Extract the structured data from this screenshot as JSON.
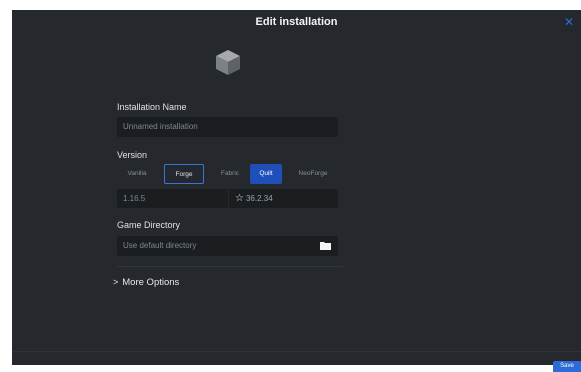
{
  "dialog": {
    "title": "Edit installation",
    "close_icon": "close-icon"
  },
  "installation_name": {
    "label": "Installation Name",
    "placeholder": "Unnamed installation"
  },
  "version": {
    "label": "Version",
    "loaders": [
      "Vanilla",
      "Forge",
      "Fabric",
      "Quilt",
      "NeoForge"
    ],
    "minecraft_version": "1.16.5",
    "loader_version": "36.2.34",
    "loader_version_icon": "star-icon"
  },
  "game_directory": {
    "label": "Game Directory",
    "placeholder": "Use default directory",
    "icon": "folder-icon"
  },
  "more_options": {
    "label": "More Options",
    "icon": "chevron-right-icon"
  },
  "footer": {
    "save_label": "Save"
  },
  "colors": {
    "background": "#25292d",
    "field": "#1b1e21",
    "accent": "#2d6bd6",
    "selected_tab": "#1f4fb9"
  }
}
